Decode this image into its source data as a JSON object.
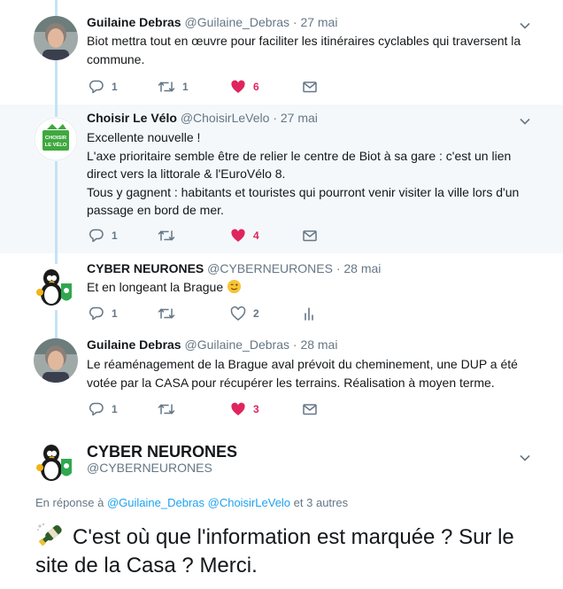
{
  "tweets": [
    {
      "name": "Guilaine Debras",
      "handle": "@Guilaine_Debras",
      "sep": "·",
      "date": "27 mai",
      "text": [
        "Biot mettra tout en œuvre pour faciliter les itinéraires cyclables qui traversent la commune."
      ],
      "replies": "1",
      "retweets": "1",
      "likes": "6",
      "liked": true
    },
    {
      "name": "Choisir Le Vélo",
      "handle": "@ChoisirLeVelo",
      "sep": "·",
      "date": "27 mai",
      "avatar_text": [
        "CHOISIR",
        "LE VÉLO"
      ],
      "text": [
        "Excellente nouvelle !",
        "L'axe prioritaire semble être de relier le centre de Biot à sa gare : c'est un lien direct vers la littorale & l'EuroVélo 8.",
        "Tous y gagnent : habitants et touristes qui pourront venir visiter la ville lors d'un passage en bord de mer."
      ],
      "replies": "1",
      "retweets": "",
      "likes": "4",
      "liked": true
    },
    {
      "name": "CYBER NEURONES",
      "handle": "@CYBERNEURONES",
      "sep": "·",
      "date": "28 mai",
      "text": [
        "Et en longeant la Brague"
      ],
      "replies": "1",
      "retweets": "",
      "likes": "2",
      "liked": false
    },
    {
      "name": "Guilaine Debras",
      "handle": "@Guilaine_Debras",
      "sep": "·",
      "date": "28 mai",
      "text": [
        "Le réaménagement de la Brague aval prévoit du cheminement, une DUP a été votée par la CASA pour récupérer les terrains. Réalisation à moyen terme."
      ],
      "replies": "1",
      "retweets": "",
      "likes": "3",
      "liked": true
    }
  ],
  "focus": {
    "name": "CYBER NEURONES",
    "handle": "@CYBERNEURONES",
    "reply_prefix": "En réponse à",
    "reply_users": [
      "@Guilaine_Debras",
      "@ChoisirLeVelo"
    ],
    "reply_suffix": "et 3 autres",
    "text": "C'est où que l'information est marquée ? Sur le site de la Casa ? Merci."
  },
  "colors": {
    "like_active": "#e0245e",
    "thread_line": "#c4e3f5",
    "highlight_bg": "#f5f8fa",
    "link": "#1da1f2",
    "muted": "#657786"
  },
  "icons": [
    "reply-icon",
    "retweet-icon",
    "like-icon",
    "direct-message-icon",
    "analytics-icon",
    "chevron-down-icon",
    "wink-emoji",
    "champagne-emoji"
  ]
}
